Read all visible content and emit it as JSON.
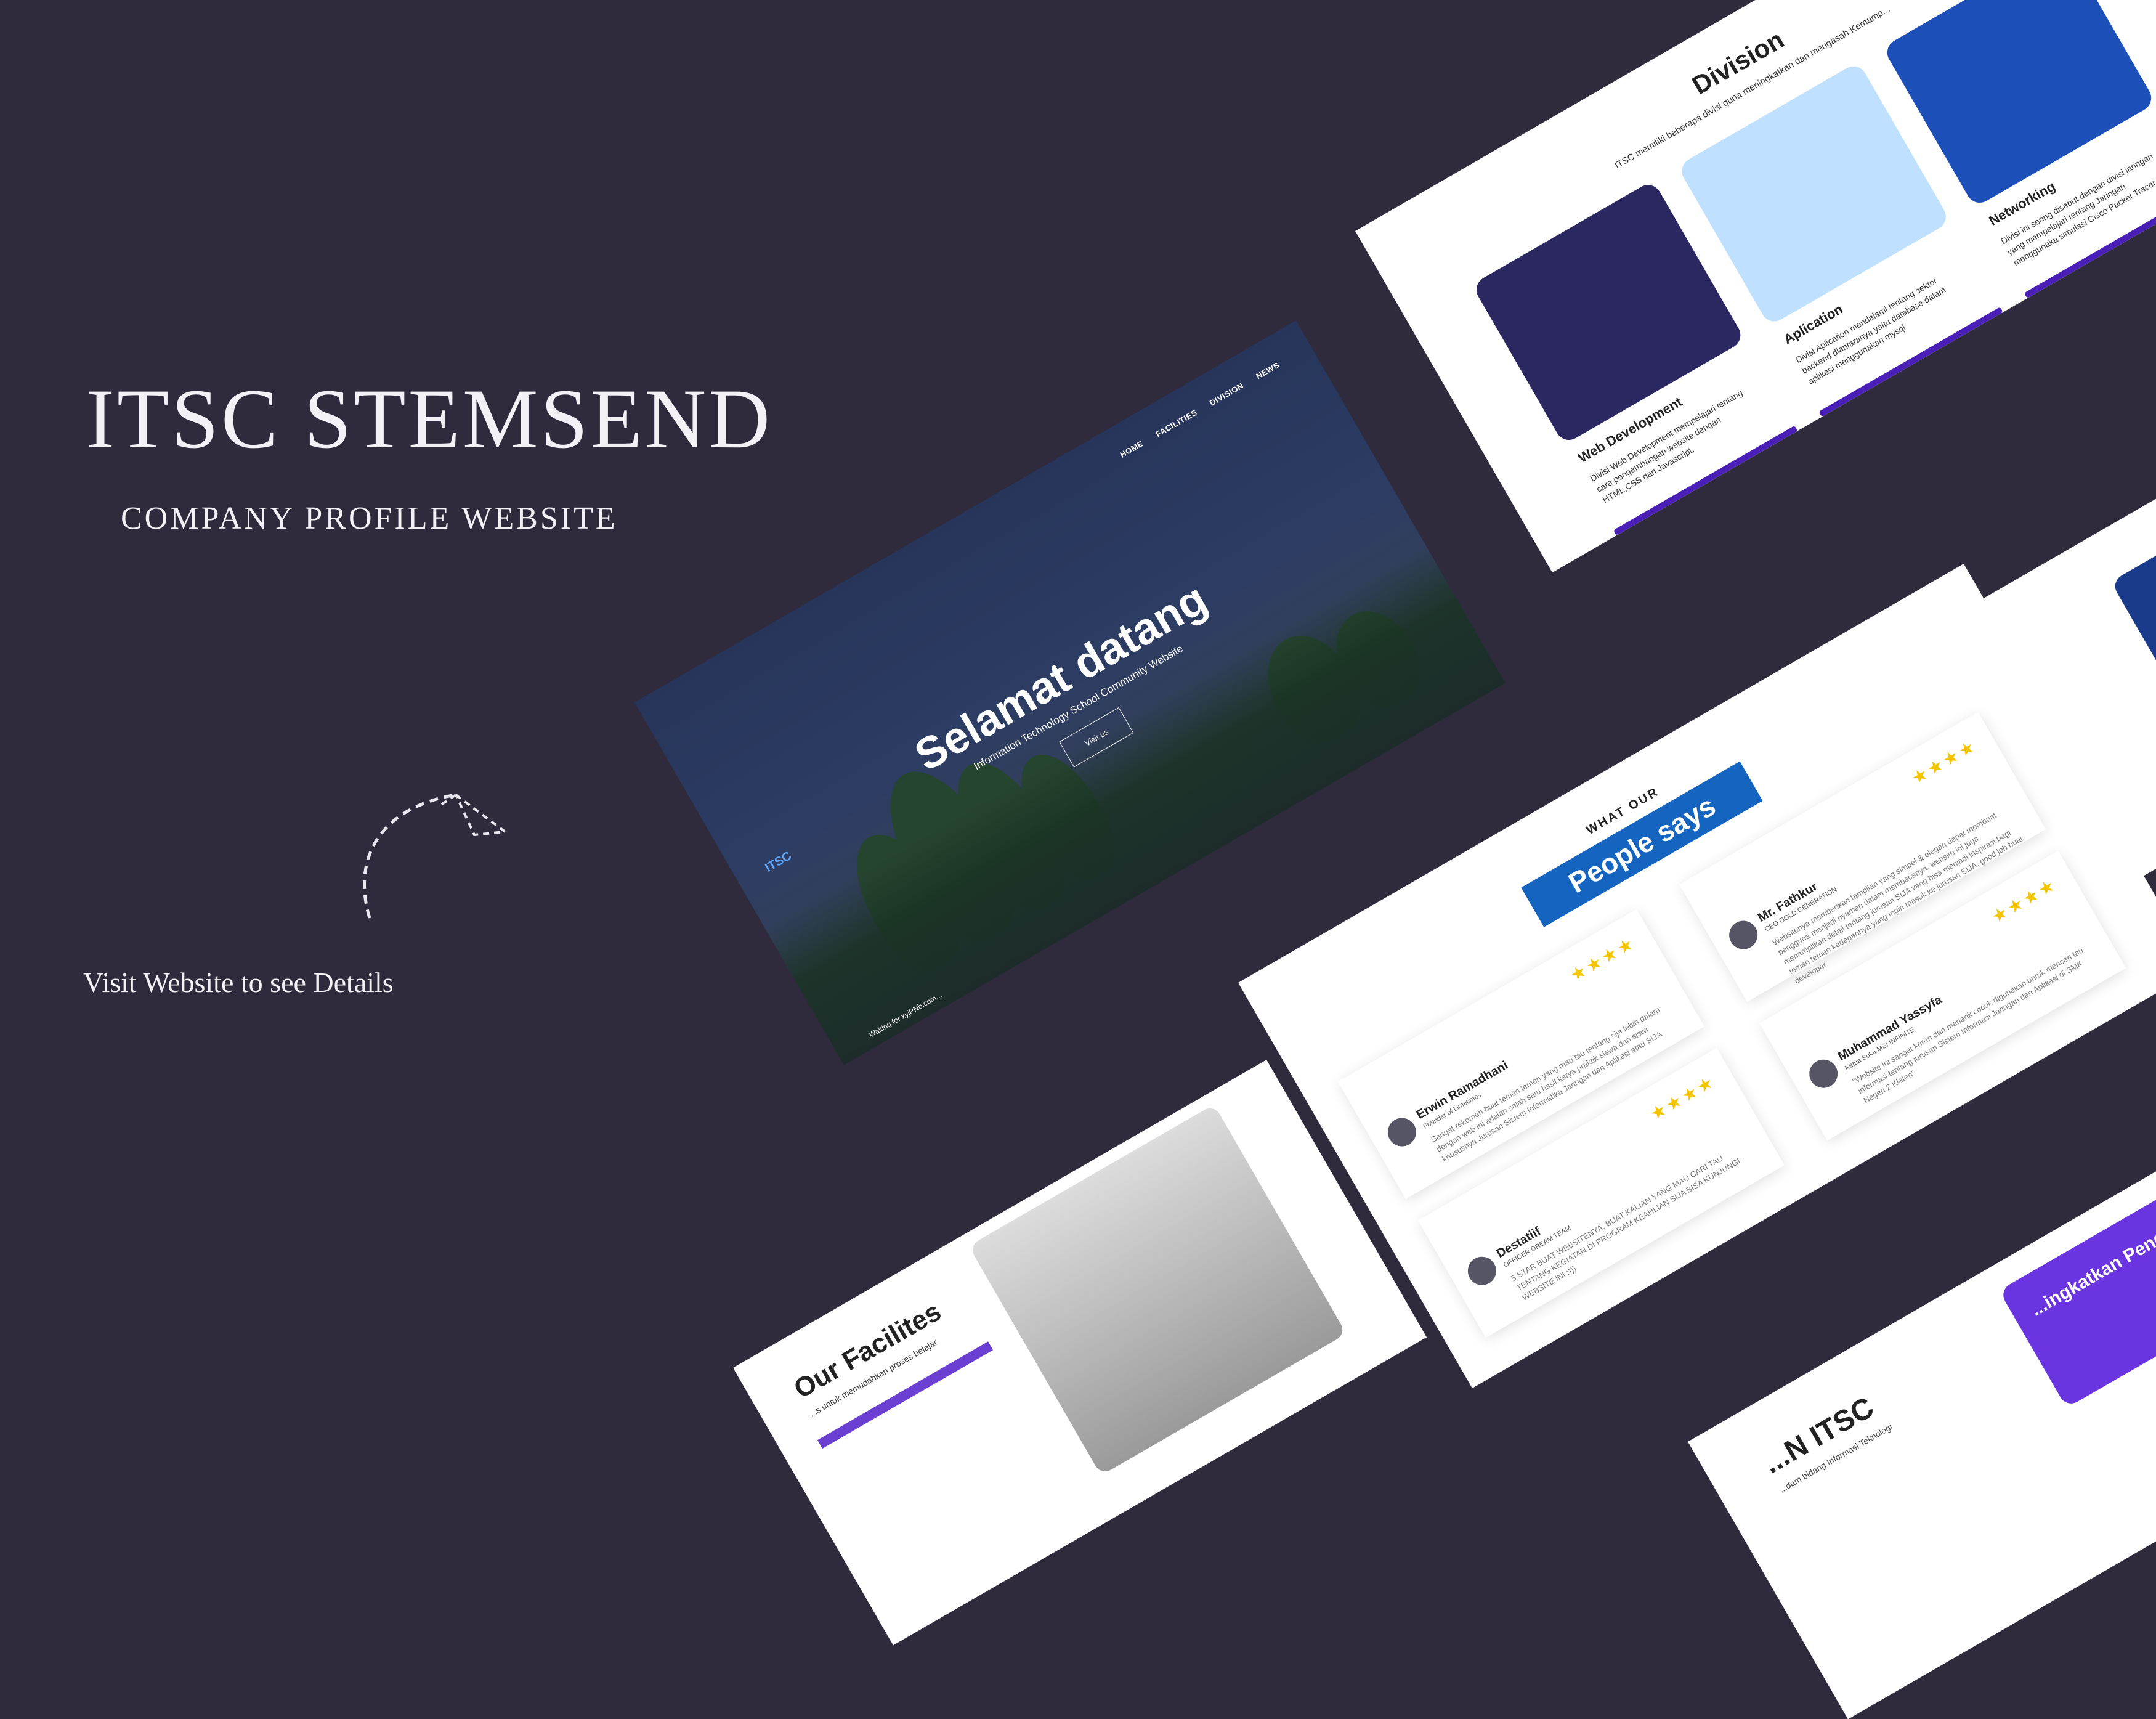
{
  "intro": {
    "title": "ITSC STEMSEND",
    "subtitle": "COMPANY PROFILE WEBSITE",
    "visit": "Visit Website to see Details"
  },
  "hero": {
    "nav": [
      "HOME",
      "FACILITIES",
      "DIVISION",
      "NEWS"
    ],
    "logo": "ITSC",
    "title": "Selamat datang",
    "subtitle": "Information Technology School Community Website",
    "button": "Visit us",
    "footer": "Waiting for xyjPNb.com..."
  },
  "division": {
    "title": "Division",
    "subtitle": "ITSC memiliki beberapa divisi guna meningkatkan dan mengasah Kemamp...",
    "cards": [
      {
        "title": "Web Development",
        "text": "Divisi Web Development mempelajari tentang cara pengembangan website dengan HTML,CSS dan Javascript.",
        "color": "#2b2760"
      },
      {
        "title": "Aplication",
        "text": "Divisi Aplication mendalami tentang sektor backend diantaranya yaitu database dalam aplikasi menggunakan mysql",
        "color": "#bfe0ff"
      },
      {
        "title": "Networking",
        "text": "Divisi ini sering disebut dengan divisi jaringan yang mempelajari tentang Jaringan menggunaka simulasi Cisco Packet Tracer",
        "color": "#1d4fb8"
      }
    ]
  },
  "people": {
    "what": "WHAT OUR",
    "tag": "People says",
    "stars": "★★★★",
    "items": [
      {
        "name": "Erwin Ramadhani",
        "role": "Founder of Limetimes",
        "text": "Sangat rekomen buat temen temen yang mau tau tentang sija lebih dalam dengan web ini adalah salah satu hasil karya praktik siswa dan siswi khususnya Jurusan Sistem Informatika Jaringan dan Aplikasi atau SIJA"
      },
      {
        "name": "Mr. Fathkur",
        "role": "CEO GOLD GENERATION",
        "text": "Websitenya memberikan tampilan yang simpel & elegan dapat membuat pengguna menjadi nyaman dalam membacanya. website ini juga menampilkan detail tentang jurusan SIJA yang bisa menjadi inspirasi bagi teman teman kedepannya yang ingin masuk ke jurusan SIJA, good job buat developer"
      },
      {
        "name": "Destatiif",
        "role": "OFFICER DREAM TEAM",
        "text": "5 STAR BUAT WEBSITENYA, BUAT KALIAN YANG MAU CARI TAU TENTANG KEGIATAN DI PROGRAM KEAHLIAN SIJA BISA KUNJUNGI WEBSITE INI :)))"
      },
      {
        "name": "Muhammad Yassyfa",
        "role": "Ketua Suka MSI INFINITE",
        "text": "\"Website ini sangat keren dan menarik cocok digunakan untuk mencari tau informasi tentang jurusan Sistem Informasi Jaringan dan Aplikasi di SMK Negeri 2 Klaten\""
      }
    ]
  },
  "facilities": {
    "title": "Our Facilites",
    "subtitle": "...s untuk memudahkan proses belajar"
  },
  "about": {
    "title": "...N ITSC",
    "subtitle": "...dam bidang Informasi Teknologi",
    "card": "...ingkatkan Pengetahuan"
  }
}
